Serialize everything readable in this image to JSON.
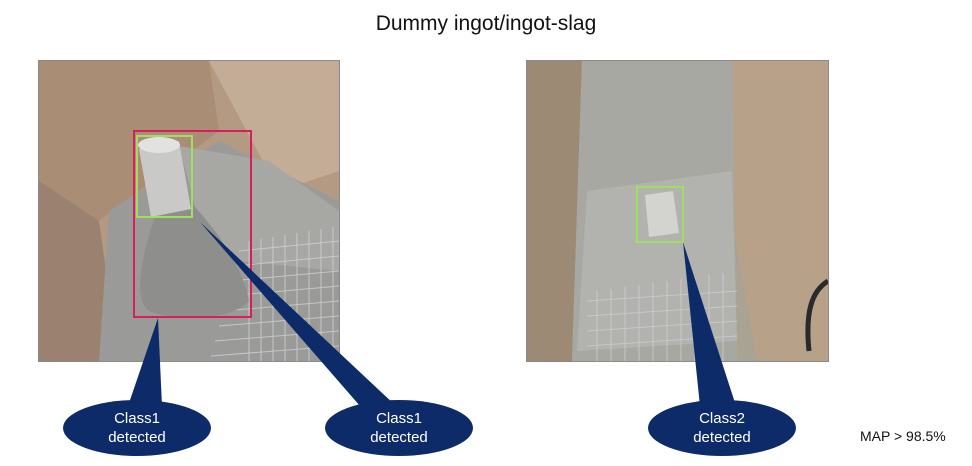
{
  "title": "Dummy ingot/ingot-slag",
  "images": {
    "left": {
      "description_icon": "photo-ingot-slag-left"
    },
    "right": {
      "description_icon": "photo-ingot-right"
    }
  },
  "callouts": [
    {
      "line1": "Class1",
      "line2": "detected"
    },
    {
      "line1": "Class1",
      "line2": "detected"
    },
    {
      "line1": "Class2",
      "line2": "detected"
    }
  ],
  "metric": "MAP > 98.5%",
  "colors": {
    "callout_fill": "#0e2b69",
    "box_class1_red": "#d81e5b",
    "box_green": "#9fe060"
  }
}
